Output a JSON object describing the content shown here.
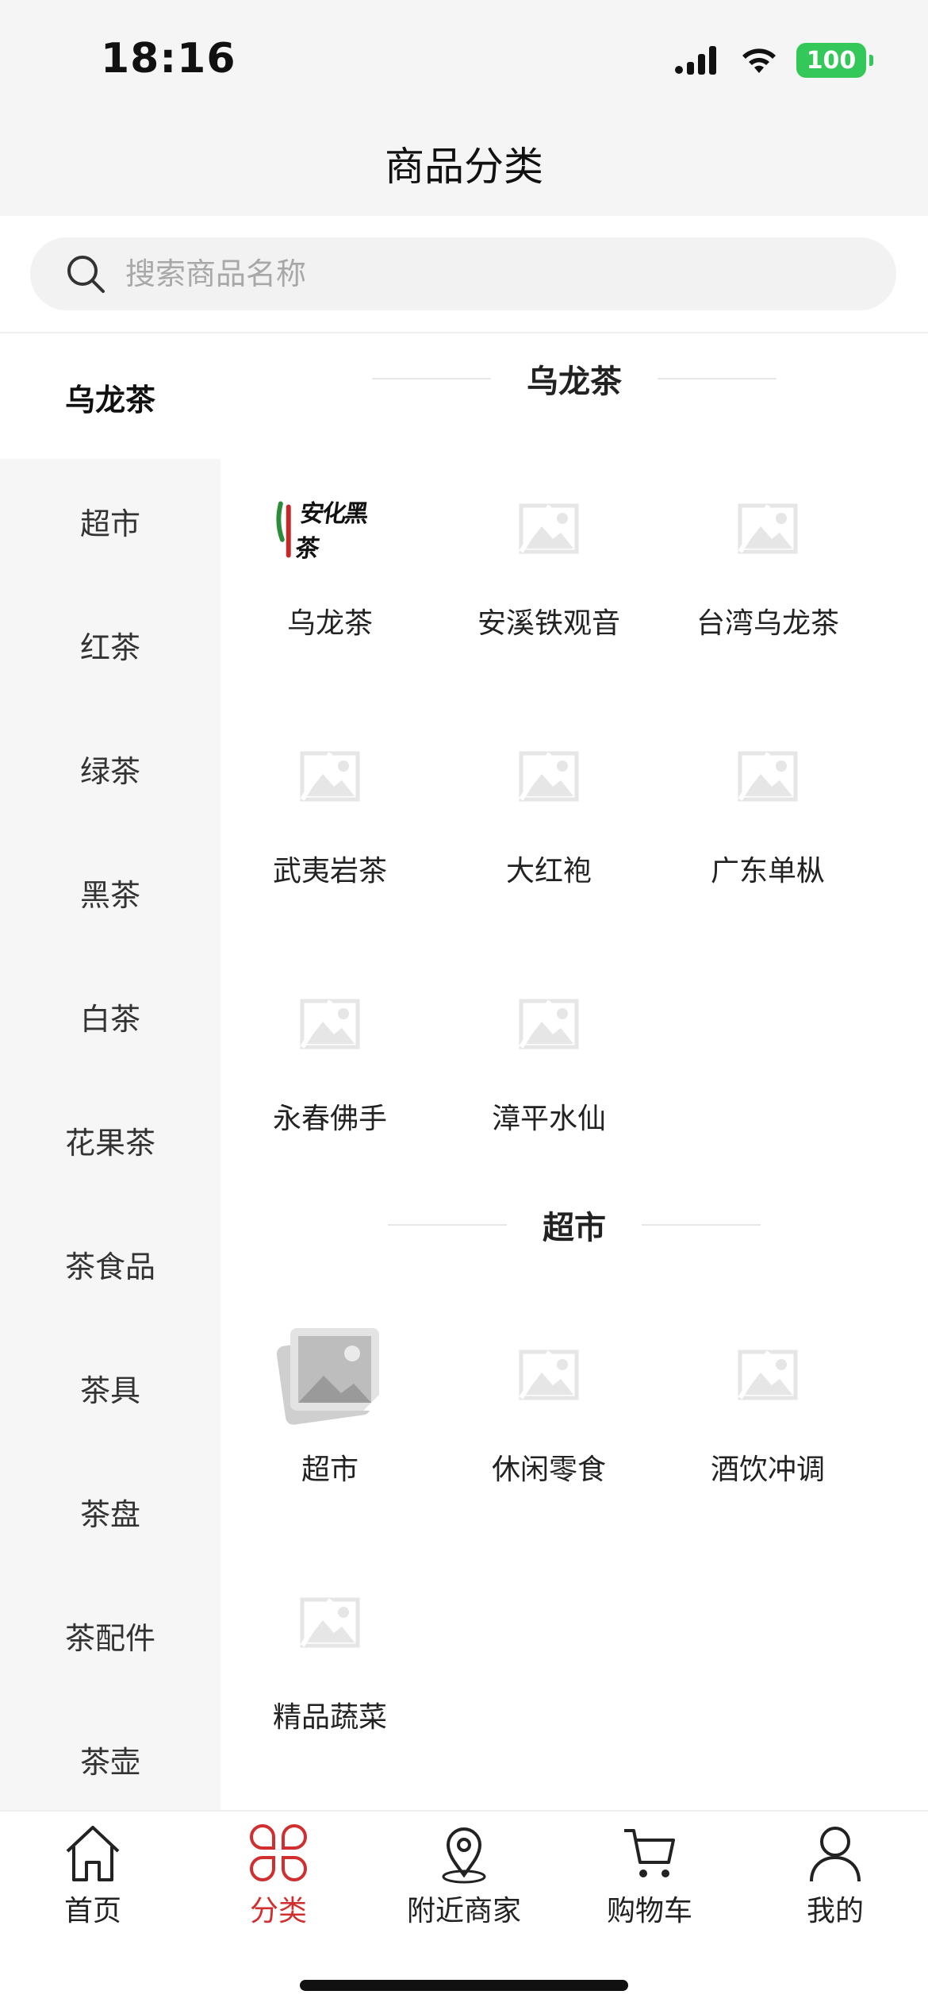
{
  "status_bar": {
    "time": "18:16",
    "battery": "100"
  },
  "header": {
    "title": "商品分类"
  },
  "search": {
    "placeholder": "搜索商品名称",
    "value": ""
  },
  "sidebar": {
    "items": [
      {
        "label": "乌龙茶",
        "active": true
      },
      {
        "label": "超市"
      },
      {
        "label": "红茶"
      },
      {
        "label": "绿茶"
      },
      {
        "label": "黑茶"
      },
      {
        "label": "白茶"
      },
      {
        "label": "花果茶"
      },
      {
        "label": "茶食品"
      },
      {
        "label": "茶具"
      },
      {
        "label": "茶盘"
      },
      {
        "label": "茶配件"
      },
      {
        "label": "茶壶"
      }
    ]
  },
  "sections": [
    {
      "title": "乌龙茶",
      "items": [
        {
          "name": "乌龙茶",
          "image": "brand-logo",
          "logo_text": "安化黑茶"
        },
        {
          "name": "安溪铁观音",
          "image": "placeholder-image-icon"
        },
        {
          "name": "台湾乌龙茶",
          "image": "placeholder-image-icon"
        },
        {
          "name": "武夷岩茶",
          "image": "placeholder-image-icon"
        },
        {
          "name": "大红袍",
          "image": "placeholder-image-icon"
        },
        {
          "name": "广东单枞",
          "image": "placeholder-image-icon"
        },
        {
          "name": "永春佛手",
          "image": "placeholder-image-icon"
        },
        {
          "name": "漳平水仙",
          "image": "placeholder-image-icon"
        }
      ]
    },
    {
      "title": "超市",
      "items": [
        {
          "name": "超市",
          "image": "photo-stack-icon"
        },
        {
          "name": "休闲零食",
          "image": "placeholder-image-icon"
        },
        {
          "name": "酒饮冲调",
          "image": "placeholder-image-icon"
        },
        {
          "name": "精品蔬菜",
          "image": "placeholder-image-icon"
        }
      ]
    }
  ],
  "tabbar": {
    "tabs": [
      {
        "label": "首页",
        "icon": "home-icon"
      },
      {
        "label": "分类",
        "icon": "category-icon",
        "active": true
      },
      {
        "label": "附近商家",
        "icon": "location-pin-icon"
      },
      {
        "label": "购物车",
        "icon": "cart-icon"
      },
      {
        "label": "我的",
        "icon": "profile-icon"
      }
    ]
  },
  "colors": {
    "accent": "#d12f2f",
    "sidebar_bg": "#f6f6f6",
    "header_bg": "#f5f5f5",
    "battery": "#34c759"
  }
}
